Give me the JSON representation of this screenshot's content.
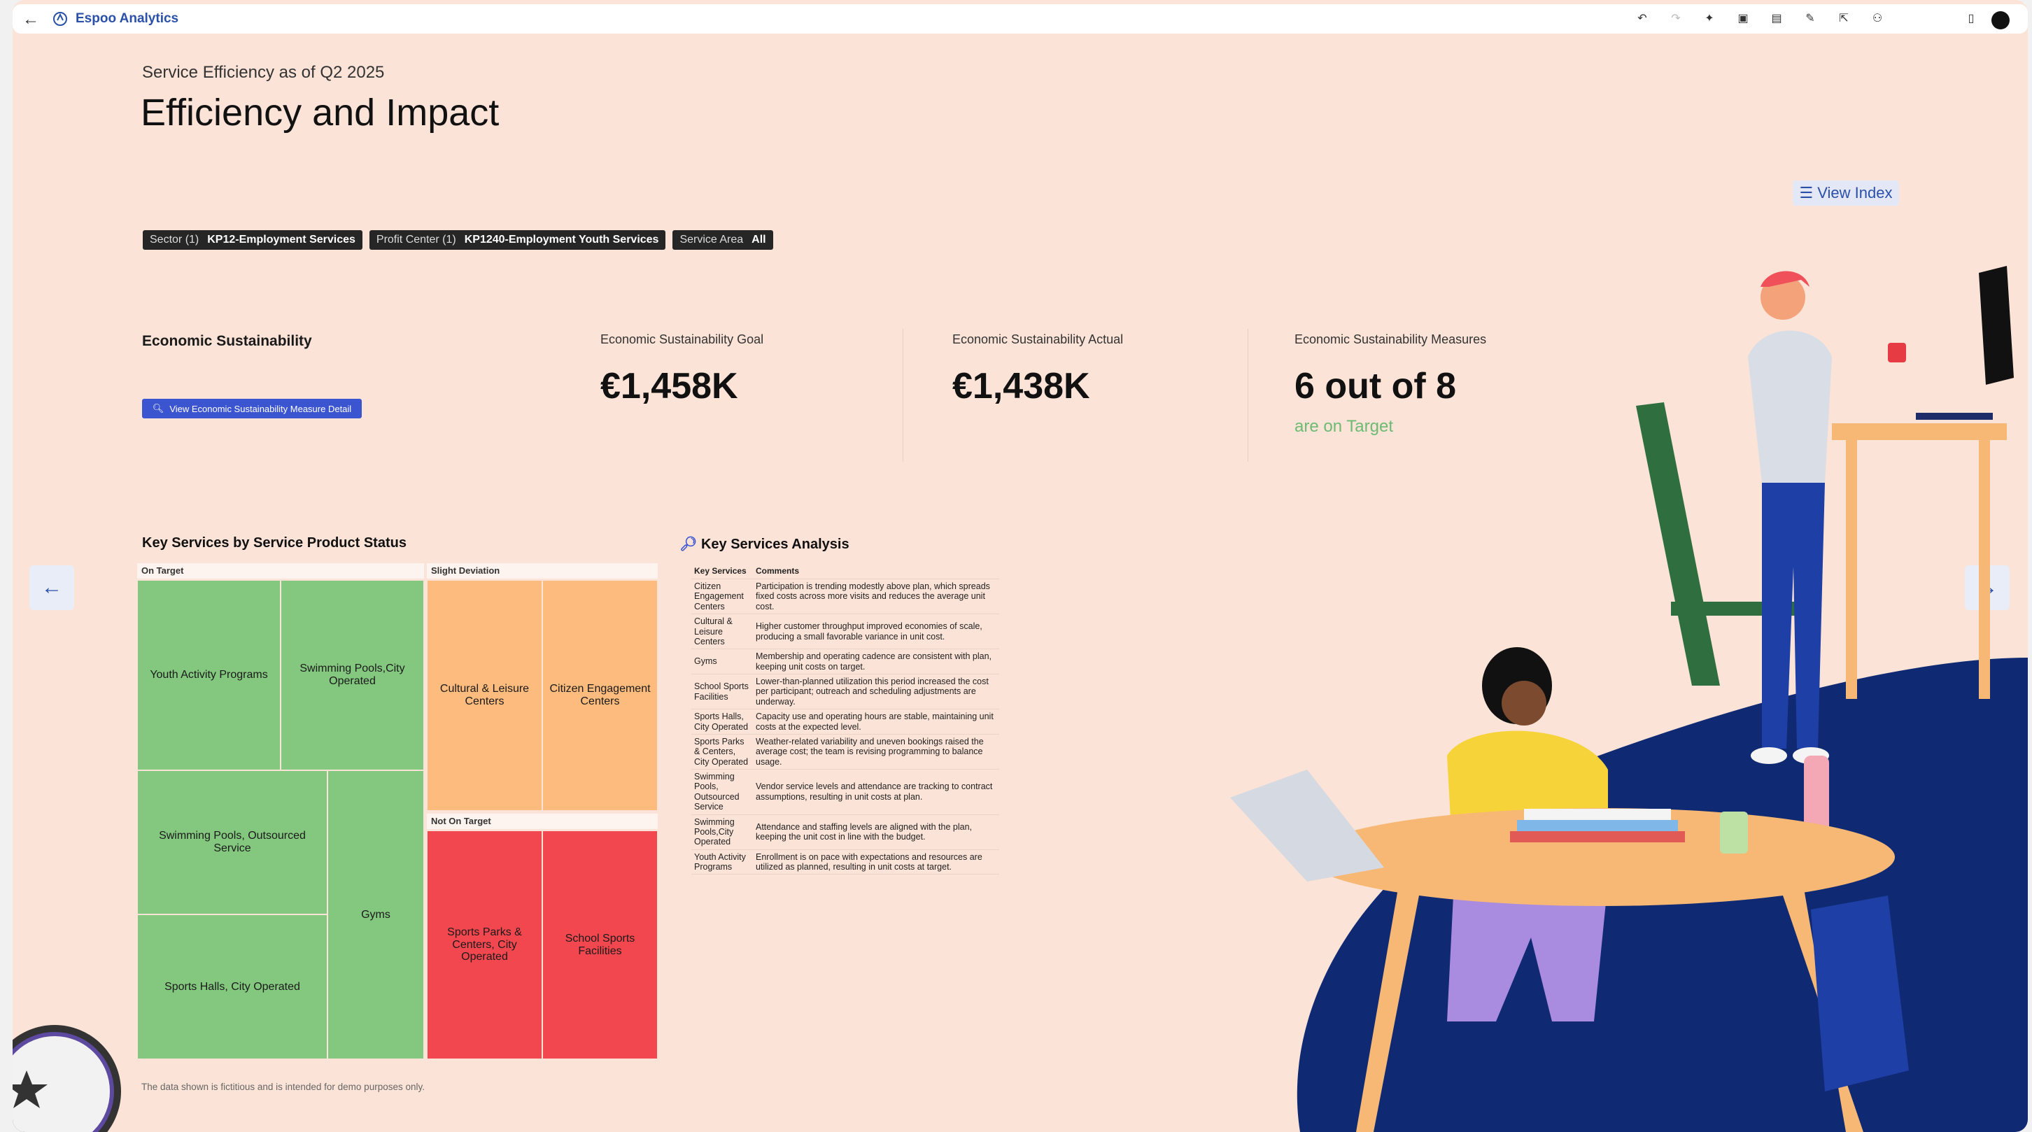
{
  "app": {
    "title": "Espoo Analytics"
  },
  "header": {
    "subtitle": "Service Efficiency as of Q2 2025",
    "title": "Efficiency and Impact",
    "view_index_label": "View Index"
  },
  "filters": [
    {
      "key": "Sector (1)",
      "value": "KP12-Employment Services"
    },
    {
      "key": "Profit Center (1)",
      "value": "KP1240-Employment Youth Services"
    },
    {
      "key": "Service Area",
      "value": "All"
    }
  ],
  "economic": {
    "heading": "Economic Sustainability",
    "detail_button": "View Economic Sustainability Measure Detail",
    "goal_label": "Economic Sustainability Goal",
    "goal_value": "€1,458K",
    "actual_label": "Economic Sustainability Actual",
    "actual_value": "€1,438K",
    "measures_label": "Economic Sustainability Measures",
    "measures_value": "6 out of 8",
    "measures_note": "are on Target"
  },
  "treemap": {
    "title": "Key Services by Service Product Status",
    "groups": {
      "on_target": "On Target",
      "slight": "Slight Deviation",
      "not_on_target": "Not On Target"
    },
    "cells": {
      "youth": "Youth Activity Programs",
      "pools_city": "Swimming Pools,City Operated",
      "pools_out": "Swimming Pools, Outsourced Service",
      "gyms": "Gyms",
      "halls": "Sports Halls, City Operated",
      "cultural": "Cultural & Leisure Centers",
      "citizen": "Citizen Engagement Centers",
      "parks": "Sports Parks & Centers, City Operated",
      "school": "School Sports Facilities"
    }
  },
  "analysis": {
    "title": "Key Services Analysis",
    "col_service": "Key Services",
    "col_comments": "Comments",
    "rows": [
      {
        "service": "Citizen Engagement Centers",
        "comment": "Participation is trending modestly above plan, which spreads fixed costs across more visits and reduces the average unit cost."
      },
      {
        "service": "Cultural & Leisure Centers",
        "comment": "Higher customer throughput improved economies of scale, producing a small favorable variance in unit cost."
      },
      {
        "service": "Gyms",
        "comment": "Membership and operating cadence are consistent with plan, keeping unit costs on target."
      },
      {
        "service": "School Sports Facilities",
        "comment": "Lower-than-planned utilization this period increased the cost per participant; outreach and scheduling adjustments are underway."
      },
      {
        "service": "Sports Halls, City Operated",
        "comment": "Capacity use and operating hours are stable, maintaining unit costs at the expected level."
      },
      {
        "service": "Sports Parks & Centers, City Operated",
        "comment": "Weather-related variability and uneven bookings raised the average cost; the team is revising programming to balance usage."
      },
      {
        "service": "Swimming Pools, Outsourced Service",
        "comment": "Vendor service levels and attendance are tracking to contract assumptions, resulting in unit costs at plan."
      },
      {
        "service": "Swimming Pools,City Operated",
        "comment": "Attendance and staffing levels are aligned with the plan, keeping the unit cost in line with the budget."
      },
      {
        "service": "Youth Activity Programs",
        "comment": "Enrollment is on pace with expectations and resources are utilized as planned, resulting in unit costs at target."
      }
    ]
  },
  "footnote": "The data shown is fictitious and is intended for demo purposes only.",
  "colors": {
    "background": "#fbe3d7",
    "on_target": "#84c87f",
    "slight_deviation": "#fdbb7e",
    "not_on_target": "#f2474e",
    "accent": "#3b55d1",
    "positive": "#6dbb73"
  },
  "icons": [
    "back-arrow-icon",
    "app-logo-icon",
    "undo-icon",
    "redo-icon",
    "magic-icon",
    "save-icon",
    "comment-icon",
    "pin-icon",
    "share-icon",
    "user-icon",
    "bookmark-icon",
    "search-icon",
    "list-icon",
    "magnifier-emoji-icon",
    "arrow-left-icon",
    "arrow-right-icon"
  ]
}
